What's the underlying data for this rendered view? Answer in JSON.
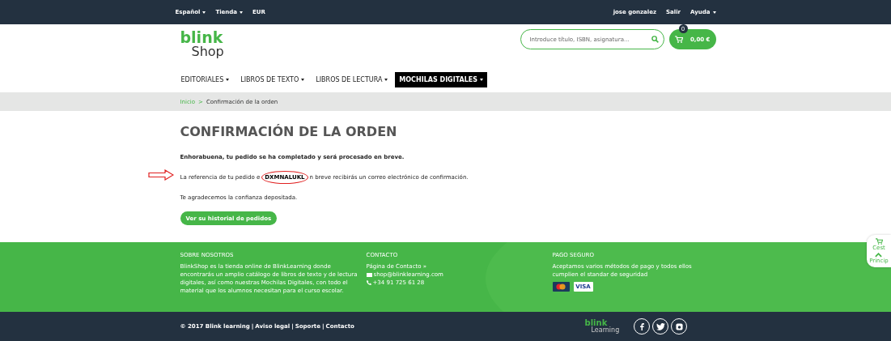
{
  "top_bar": {
    "left": [
      {
        "label": "Español",
        "dropdown": true
      },
      {
        "label": "Tienda",
        "dropdown": true
      },
      {
        "label": "EUR",
        "dropdown": false
      }
    ],
    "right": [
      {
        "label": "jose gonzalez",
        "dropdown": false
      },
      {
        "label": "Salir",
        "dropdown": false
      },
      {
        "label": "Ayuda",
        "dropdown": true
      }
    ]
  },
  "logo": {
    "brand": "blink",
    "sub": "Shop"
  },
  "search": {
    "placeholder": "Introduce título, ISBN, asignatura..."
  },
  "cart": {
    "count": "0",
    "total": "0,00 €"
  },
  "nav": [
    {
      "label": "EDITORIALES",
      "selected": false
    },
    {
      "label": "LIBROS DE TEXTO",
      "selected": false
    },
    {
      "label": "LIBROS DE LECTURA",
      "selected": false
    },
    {
      "label": "MOCHILAS DIGITALES",
      "selected": true
    }
  ],
  "breadcrumb": [
    {
      "label": "Inicio",
      "link": true
    },
    {
      "label": "Confirmación de la orden",
      "link": false
    }
  ],
  "breadcrumb_separator": ">",
  "title": "CONFIRMACIÓN DE LA ORDEN",
  "success": "Enhorabuena, tu pedido se ha completado y será procesado en breve.",
  "reference": {
    "before": "La referencia de tu pedido e",
    "code": "DXMNALUKL",
    "after": "n breve recibirás un correo electrónico de confirmación."
  },
  "thanks": "Te agradecemos la confianza depositada.",
  "history_button": "Ver su historial de pedidos",
  "footer": {
    "about": {
      "heading": "SOBRE NOSOTROS",
      "text": "BlinkShop es la tienda online de BlinkLearning donde encontrarás un amplio catálogo de libros de texto y de lectura digitales, así como nuestras Mochilas Digitales, con todo el material que los alumnos necesitan para el curso escolar."
    },
    "contact": {
      "heading": "CONTACTO",
      "items": [
        {
          "kind": "link",
          "text": "Página de Contacto »"
        },
        {
          "kind": "email",
          "text": "shop@blinklearning.com"
        },
        {
          "kind": "phone",
          "text": "+34 91 725 61 28"
        }
      ]
    },
    "payment": {
      "heading": "PAGO SEGURO",
      "text": "Aceptamos varios métodos de pago y todos ellos cumplien el standar de seguridad",
      "cards": [
        {
          "kind": "mastercard"
        },
        {
          "kind": "visa",
          "label": "VISA"
        }
      ]
    }
  },
  "bottom": {
    "copyright": "© 2017 Blink learning",
    "links": [
      "Aviso legal",
      "Soporte",
      "Contacto"
    ],
    "separator": "|",
    "logo_brand": "blink",
    "logo_sub": "Learning",
    "social": [
      {
        "kind": "facebook"
      },
      {
        "kind": "twitter"
      },
      {
        "kind": "instagram"
      }
    ]
  },
  "side_widget": [
    {
      "kind": "cart",
      "label": "Cest"
    },
    {
      "kind": "up",
      "label": "Princip"
    }
  ]
}
